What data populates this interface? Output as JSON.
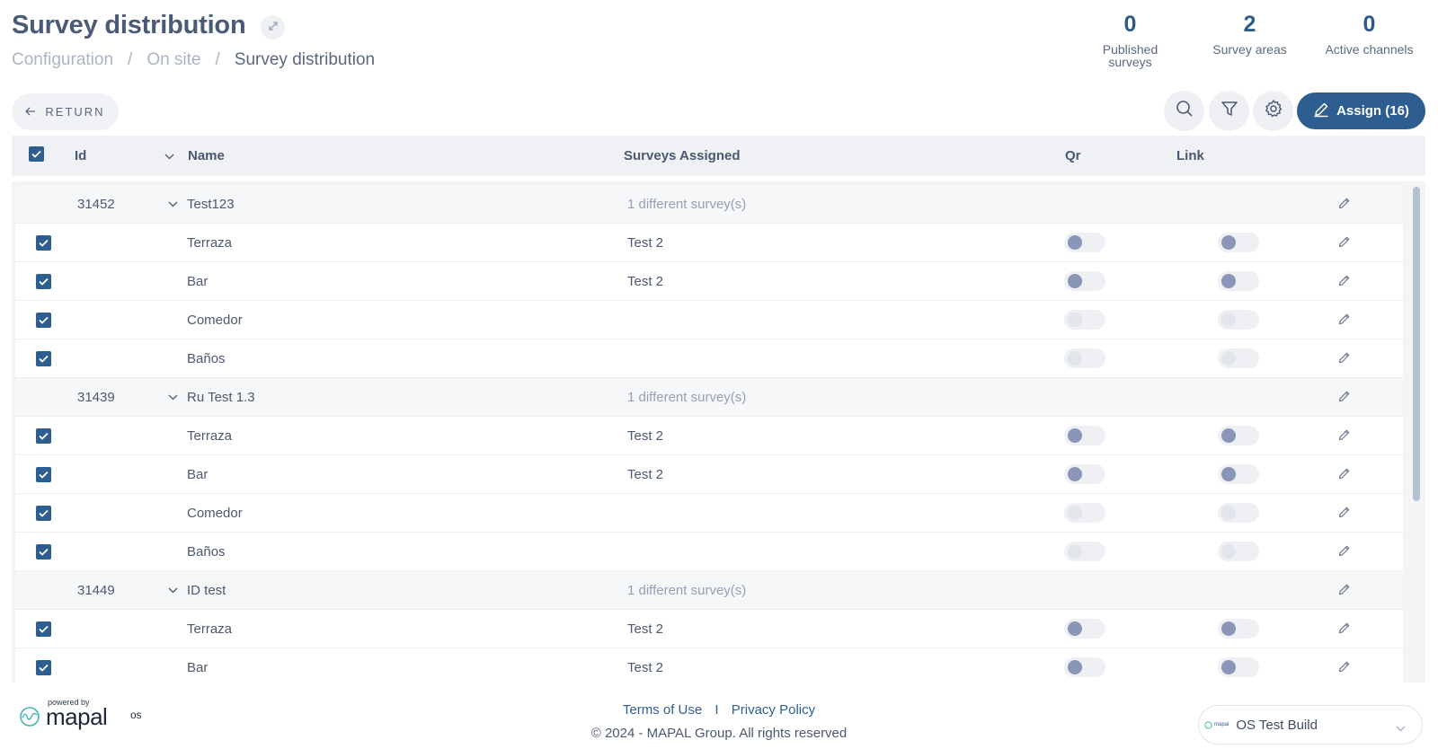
{
  "header": {
    "title": "Survey distribution",
    "breadcrumb": [
      "Configuration",
      "On site",
      "Survey distribution"
    ],
    "separator": "/"
  },
  "stats": [
    {
      "value": "0",
      "label": "Published surveys"
    },
    {
      "value": "2",
      "label": "Survey areas"
    },
    {
      "value": "0",
      "label": "Active channels"
    }
  ],
  "toolbar": {
    "return_label": "RETURN",
    "assign_label": "Assign (16)"
  },
  "table": {
    "columns": {
      "id": "Id",
      "name": "Name",
      "surveys": "Surveys Assigned",
      "qr": "Qr",
      "link": "Link"
    },
    "groups": [
      {
        "id": "31452",
        "name": "Test123",
        "summary": "1 different survey(s)",
        "children": [
          {
            "name": "Terraza",
            "survey": "Test 2",
            "qr_enabled": true,
            "link_enabled": true
          },
          {
            "name": "Bar",
            "survey": "Test 2",
            "qr_enabled": true,
            "link_enabled": true
          },
          {
            "name": "Comedor",
            "survey": "",
            "qr_enabled": false,
            "link_enabled": false
          },
          {
            "name": "Baños",
            "survey": "",
            "qr_enabled": false,
            "link_enabled": false
          }
        ]
      },
      {
        "id": "31439",
        "name": "Ru Test 1.3",
        "summary": "1 different survey(s)",
        "children": [
          {
            "name": "Terraza",
            "survey": "Test 2",
            "qr_enabled": true,
            "link_enabled": true
          },
          {
            "name": "Bar",
            "survey": "Test 2",
            "qr_enabled": true,
            "link_enabled": true
          },
          {
            "name": "Comedor",
            "survey": "",
            "qr_enabled": false,
            "link_enabled": false
          },
          {
            "name": "Baños",
            "survey": "",
            "qr_enabled": false,
            "link_enabled": false
          }
        ]
      },
      {
        "id": "31449",
        "name": "ID test",
        "summary": "1 different survey(s)",
        "children": [
          {
            "name": "Terraza",
            "survey": "Test 2",
            "qr_enabled": true,
            "link_enabled": true
          },
          {
            "name": "Bar",
            "survey": "Test 2",
            "qr_enabled": true,
            "link_enabled": true
          }
        ]
      }
    ]
  },
  "footer": {
    "powered_by": "powered by",
    "brand": "mapal",
    "brand_suffix": "os",
    "terms": "Terms of Use",
    "links_separator": "I",
    "privacy": "Privacy Policy",
    "copyright": "© 2024 - MAPAL Group. All rights reserved",
    "environment_mini": "mapal",
    "environment": "OS Test Build"
  },
  "colors": {
    "primary": "#2d5e8f",
    "title": "#4a5b78",
    "muted": "#96a0b2",
    "toggle_knob": "#8996b8"
  }
}
